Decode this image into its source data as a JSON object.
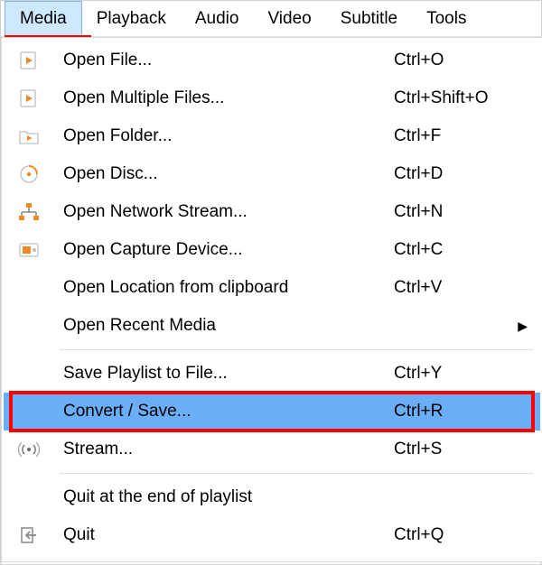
{
  "menubar": {
    "items": [
      {
        "label": "Media"
      },
      {
        "label": "Playback"
      },
      {
        "label": "Audio"
      },
      {
        "label": "Video"
      },
      {
        "label": "Subtitle"
      },
      {
        "label": "Tools"
      }
    ]
  },
  "dropdown": {
    "groups": [
      [
        {
          "icon": "file-play",
          "label": "Open File...",
          "shortcut": "Ctrl+O"
        },
        {
          "icon": "file-play",
          "label": "Open Multiple Files...",
          "shortcut": "Ctrl+Shift+O"
        },
        {
          "icon": "folder-play",
          "label": "Open Folder...",
          "shortcut": "Ctrl+F"
        },
        {
          "icon": "disc",
          "label": "Open Disc...",
          "shortcut": "Ctrl+D"
        },
        {
          "icon": "network",
          "label": "Open Network Stream...",
          "shortcut": "Ctrl+N"
        },
        {
          "icon": "capture",
          "label": "Open Capture Device...",
          "shortcut": "Ctrl+C"
        },
        {
          "icon": "",
          "label": "Open Location from clipboard",
          "shortcut": "Ctrl+V"
        },
        {
          "icon": "",
          "label": "Open Recent Media",
          "shortcut": "",
          "submenu": true
        }
      ],
      [
        {
          "icon": "",
          "label": "Save Playlist to File...",
          "shortcut": "Ctrl+Y"
        },
        {
          "icon": "",
          "label": "Convert / Save...",
          "shortcut": "Ctrl+R",
          "highlighted": true,
          "outlined": true
        },
        {
          "icon": "stream",
          "label": "Stream...",
          "shortcut": "Ctrl+S"
        }
      ],
      [
        {
          "icon": "",
          "label": "Quit at the end of playlist",
          "shortcut": ""
        },
        {
          "icon": "quit",
          "label": "Quit",
          "shortcut": "Ctrl+Q"
        }
      ]
    ]
  }
}
